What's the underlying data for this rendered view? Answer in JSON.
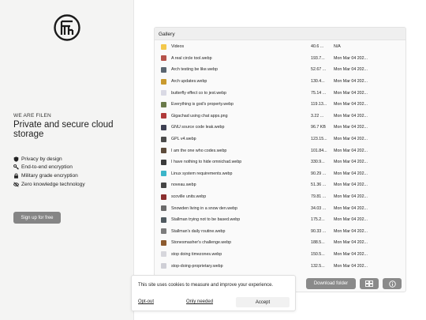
{
  "brand": {
    "eyebrow": "WE ARE FILEN",
    "tagline": "Private and secure cloud storage",
    "features": [
      {
        "icon": "shield-icon",
        "label": "Privacy by design"
      },
      {
        "icon": "key-icon",
        "label": "End-to-end encryption"
      },
      {
        "icon": "lock-icon",
        "label": "Military grade encryption"
      },
      {
        "icon": "eye-off-icon",
        "label": "Zero knowledge technology"
      }
    ],
    "signup_label": "Sign up for free"
  },
  "gallery": {
    "title": "Gallery",
    "files": [
      {
        "name": "Videos",
        "size": "40.6 ...",
        "modified": "N/A",
        "icon_color": "#f3c84b"
      },
      {
        "name": "A real circle tool.webp",
        "size": "193.7...",
        "modified": "Mon Mar 04 202...",
        "icon_color": "#b5524a"
      },
      {
        "name": "Arch testing be like.webp",
        "size": "52.67 ...",
        "modified": "Mon Mar 04 202...",
        "icon_color": "#5a6570"
      },
      {
        "name": "Arch updates.webp",
        "size": "130.4...",
        "modified": "Mon Mar 04 202...",
        "icon_color": "#c99a2e"
      },
      {
        "name": "butterfly effect co to jest.webp",
        "size": "75.14 ...",
        "modified": "Mon Mar 04 202...",
        "icon_color": "#d9d9e4"
      },
      {
        "name": "Everything is god's property.webp",
        "size": "119.13...",
        "modified": "Mon Mar 04 202...",
        "icon_color": "#6a7a4a"
      },
      {
        "name": "Gigachad using chat apps.png",
        "size": "3.22 ...",
        "modified": "Mon Mar 04 202...",
        "icon_color": "#b03a3a"
      },
      {
        "name": "GNU source code leak.webp",
        "size": "96.7 KB",
        "modified": "Mon Mar 04 202...",
        "icon_color": "#3d3f52"
      },
      {
        "name": "GPL v4.webp",
        "size": "123.15...",
        "modified": "Mon Mar 04 202...",
        "icon_color": "#4b4b4b"
      },
      {
        "name": "I am the one who codes.webp",
        "size": "101.84...",
        "modified": "Mon Mar 04 202...",
        "icon_color": "#5c4a3a"
      },
      {
        "name": "I have nothing to hide omnichad.webp",
        "size": "330.9...",
        "modified": "Mon Mar 04 202...",
        "icon_color": "#3a3a3a"
      },
      {
        "name": "Linux system requirements.webp",
        "size": "90.29 ...",
        "modified": "Mon Mar 04 202...",
        "icon_color": "#3bb5c9"
      },
      {
        "name": "noveau.webp",
        "size": "51.36 ...",
        "modified": "Mon Mar 04 202...",
        "icon_color": "#454545"
      },
      {
        "name": "scoville units.webp",
        "size": "79.81 ...",
        "modified": "Mon Mar 04 202...",
        "icon_color": "#8a2f2f"
      },
      {
        "name": "Snowden living in a snow den.webp",
        "size": "34.03 ...",
        "modified": "Mon Mar 04 202...",
        "icon_color": "#6b6b6b"
      },
      {
        "name": "Stallman trying not to be based.webp",
        "size": "175.2...",
        "modified": "Mon Mar 04 202...",
        "icon_color": "#505a60"
      },
      {
        "name": "Stallman's daily routine.webp",
        "size": "90.33 ...",
        "modified": "Mon Mar 04 202...",
        "icon_color": "#7c7c7c"
      },
      {
        "name": "Stonesmasher's challenge.webp",
        "size": "188.5...",
        "modified": "Mon Mar 04 202...",
        "icon_color": "#8c5a2e"
      },
      {
        "name": "stop doing timezones.webp",
        "size": "150.5...",
        "modified": "Mon Mar 04 202...",
        "icon_color": "#d6d6dc"
      },
      {
        "name": "stop-doing-proprietary.webp",
        "size": "132.5...",
        "modified": "Mon Mar 04 202...",
        "icon_color": "#cfcfd6"
      }
    ]
  },
  "actions": {
    "download_label": "Download folder",
    "grid_icon": "grid-icon",
    "info_icon": "info-icon"
  },
  "cookie": {
    "message": "This site uses cookies to measure and improve your experience.",
    "optout_label": "Opt-out",
    "needed_label": "Only needed",
    "accept_label": "Accept"
  }
}
